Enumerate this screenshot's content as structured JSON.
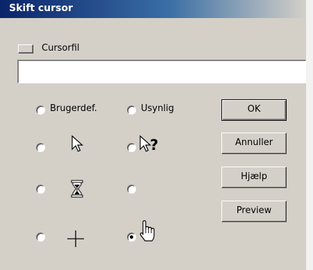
{
  "window": {
    "title": "Skift cursor"
  },
  "cursor_file": {
    "label": "Cursorfil",
    "value": ""
  },
  "options": {
    "custom": {
      "label": "Brugerdef.",
      "selected": false
    },
    "invisible": {
      "label": "Usynlig",
      "selected": false
    },
    "arrow": {
      "icon": "arrow-cursor-icon",
      "selected": false
    },
    "help": {
      "icon": "help-cursor-icon",
      "selected": false
    },
    "hourglass": {
      "icon": "hourglass-cursor-icon",
      "selected": false
    },
    "blank": {
      "icon": "",
      "selected": false
    },
    "crosshair": {
      "icon": "crosshair-cursor-icon",
      "selected": false
    },
    "hand": {
      "icon": "hand-cursor-icon",
      "selected": true
    }
  },
  "buttons": {
    "ok": "OK",
    "cancel": "Annuller",
    "help": "Hjælp",
    "preview": "Preview"
  }
}
